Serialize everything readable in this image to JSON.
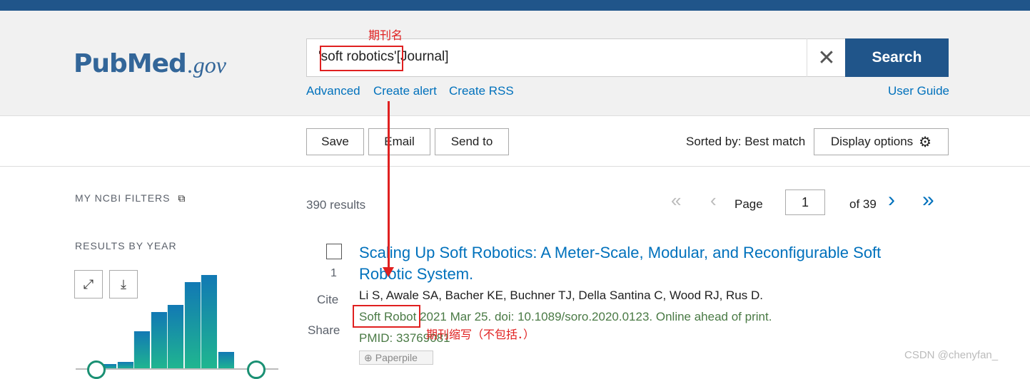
{
  "header": {
    "logo_main": "PubMed",
    "logo_suffix": ".gov",
    "query": "'soft robotics'[Journal]",
    "search_label": "Search",
    "links": [
      "Advanced",
      "Create alert",
      "Create RSS"
    ],
    "user_guide": "User Guide"
  },
  "toolbar": {
    "save": "Save",
    "email": "Email",
    "send_to": "Send to",
    "sorted_by": "Sorted by: Best match",
    "display_options": "Display options"
  },
  "sidebar": {
    "my_ncbi_filters": "MY NCBI FILTERS",
    "results_by_year": "RESULTS BY YEAR",
    "chart_data": {
      "type": "bar",
      "relative_heights": [
        8,
        11,
        54,
        81,
        91,
        123,
        133,
        25
      ]
    }
  },
  "results": {
    "count": "390 results",
    "page_label": "Page",
    "page": "1",
    "of_pages": "of 39"
  },
  "article": {
    "number": "1",
    "title": "Scaling Up Soft Robotics: A Meter-Scale, Modular, and Reconfigurable Soft Robotic System.",
    "authors": "Li S, Awale SA, Bacher KE, Buchner TJ, Della Santina C, Wood RJ, Rus D.",
    "journal": "Soft Robot",
    "citation": "2021 Mar 25. doi: 10.1089/soro.2020.0123. Online ahead of print.",
    "pmid": "PMID: 33769081",
    "cite": "Cite",
    "share": "Share",
    "paperpile": "Paperpile"
  },
  "annotations": {
    "journal_name": "期刊名",
    "journal_abbr": "期刊缩写（不包括．）"
  },
  "watermark": "CSDN @chenyfan_",
  "colors": {
    "brand": "#20558a",
    "link": "#0071bc",
    "journal": "#4a7a45",
    "annotation": "#e02020"
  }
}
